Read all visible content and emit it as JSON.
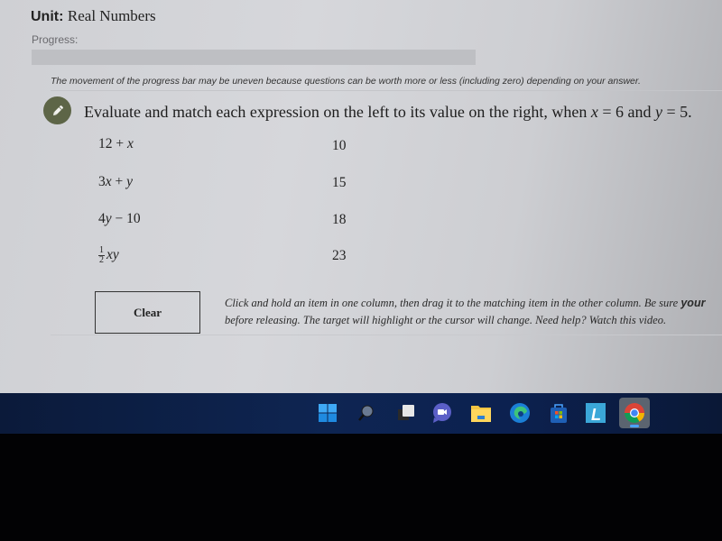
{
  "header": {
    "unit_label": "Unit:",
    "unit_name": "Real Numbers",
    "progress_label": "Progress:",
    "progress_percent": 0,
    "progress_note": "The movement of the progress bar may be uneven because questions can be worth more or less (including zero) depending on your answer."
  },
  "question": {
    "icon": "pencil-icon",
    "prompt_start": "Evaluate and match each expression on the left to its value on the right, when ",
    "var_x": "x",
    "eq_x": " = 6 and ",
    "var_y": "y",
    "eq_y": " = 5."
  },
  "matching": {
    "left_items": [
      {
        "text_a": "12 + ",
        "var": "x"
      },
      {
        "text_a": "3",
        "var_a": "x",
        "text_b": " + ",
        "var_b": "y"
      },
      {
        "text_a": "4",
        "var_a": "y",
        "text_b": " − 10"
      },
      {
        "frac_num": "1",
        "frac_den": "2",
        "vars": "xy"
      }
    ],
    "right_items": [
      "10",
      "15",
      "18",
      "23"
    ]
  },
  "controls": {
    "clear_label": "Clear",
    "instructions_line1": "Click and hold an item in one column, then drag it to the matching item in the other column. Be sure ",
    "instructions_line1_bold": "your",
    "instructions_line2": "before releasing. The target will highlight or the cursor will change. Need help? Watch this video."
  },
  "taskbar": {
    "icons": [
      "windows-start-icon",
      "search-icon",
      "task-view-icon",
      "chat-icon",
      "file-explorer-icon",
      "edge-icon",
      "store-icon",
      "l-app-icon",
      "chrome-icon"
    ],
    "active": "chrome-icon"
  },
  "colors": {
    "badge": "#5d6547",
    "taskbar": "#0e2552",
    "progress_track": "#bebfc3"
  }
}
